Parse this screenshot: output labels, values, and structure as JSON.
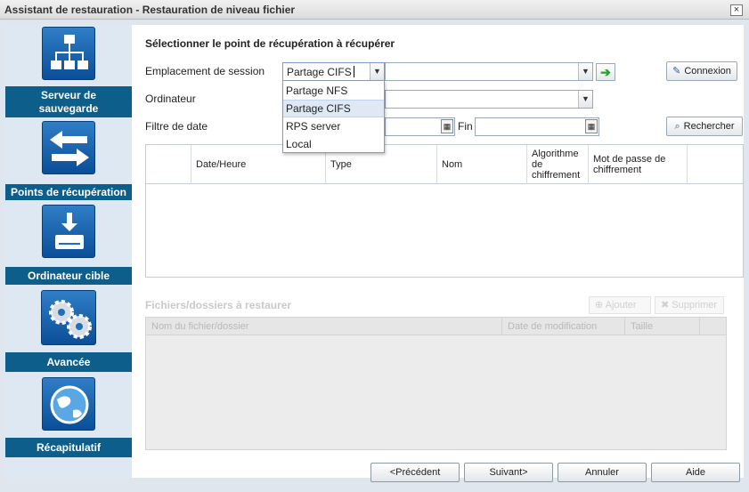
{
  "window": {
    "title": "Assistant de restauration - Restauration de niveau fichier",
    "close_glyph": "×"
  },
  "sidebar": {
    "items": [
      {
        "label_line1": "Serveur de",
        "label_line2": "sauvegarde",
        "icon": "network-tree-icon"
      },
      {
        "label": "Points de récupération",
        "icon": "swap-arrows-icon"
      },
      {
        "label": "Ordinateur cible",
        "icon": "download-drive-icon"
      },
      {
        "label": "Avancée",
        "icon": "gears-icon"
      },
      {
        "label": "Récapitulatif",
        "icon": "globe-icon"
      }
    ]
  },
  "main": {
    "section_title": "Sélectionner le point de récupération à récupérer",
    "session_label": "Emplacement de session",
    "session_value": "Partage CIFS",
    "connect_button": "Connexion",
    "computer_label": "Ordinateur",
    "date_filter_label": "Filtre de date",
    "end_label": "Fin",
    "search_button": "Rechercher",
    "grid_columns": [
      "Date/Heure",
      "Type",
      "Nom",
      "Algorithme de chiffrement",
      "Mot de passe de chiffrement"
    ],
    "files_title": "Fichiers/dossiers à restaurer",
    "add_button": "Ajouter",
    "remove_button": "Supprimer",
    "files_columns": [
      "Nom du fichier/dossier",
      "Date de modification",
      "Taille"
    ]
  },
  "dropdown": {
    "options": [
      "Partage NFS",
      "Partage CIFS",
      "RPS server",
      "Local"
    ],
    "selected": "Partage CIFS"
  },
  "footer": {
    "previous": "<Précédent",
    "next": "Suivant>",
    "cancel": "Annuler",
    "help": "Aide"
  },
  "colors": {
    "nav_label_bg": "#0e5e8c",
    "icon_blue": "#1f6fbf",
    "frame_bg": "#dfe6ee"
  }
}
